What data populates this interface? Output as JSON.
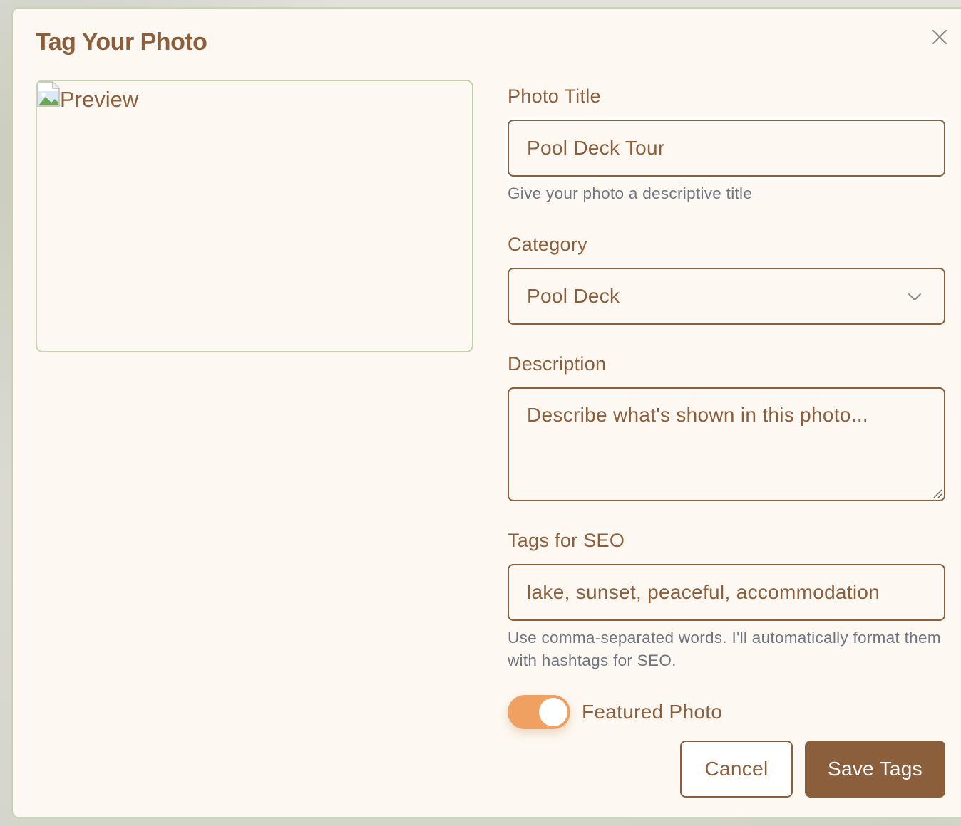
{
  "modal": {
    "title": "Tag Your Photo",
    "close_icon": "close-icon"
  },
  "preview": {
    "alt_text": "Preview",
    "icon": "broken-image-icon"
  },
  "form": {
    "title_label": "Photo Title",
    "title_value": "Pool Deck Tour",
    "title_helper": "Give your photo a descriptive title",
    "category_label": "Category",
    "category_value": "Pool Deck",
    "category_icon": "chevron-down-icon",
    "description_label": "Description",
    "description_placeholder": "Describe what's shown in this photo...",
    "tags_label": "Tags for SEO",
    "tags_value": "lake, sunset, peaceful, accommodation",
    "tags_helper": "Use comma-separated words. I'll automatically format them with hashtags for SEO.",
    "featured_label": "Featured Photo",
    "featured_on": true
  },
  "actions": {
    "cancel_label": "Cancel",
    "save_label": "Save Tags"
  },
  "colors": {
    "accent_brown": "#8b5e3c",
    "toggle_orange": "#f0a060",
    "border_green": "#c6d4b2",
    "surface": "#fdf8f1"
  }
}
